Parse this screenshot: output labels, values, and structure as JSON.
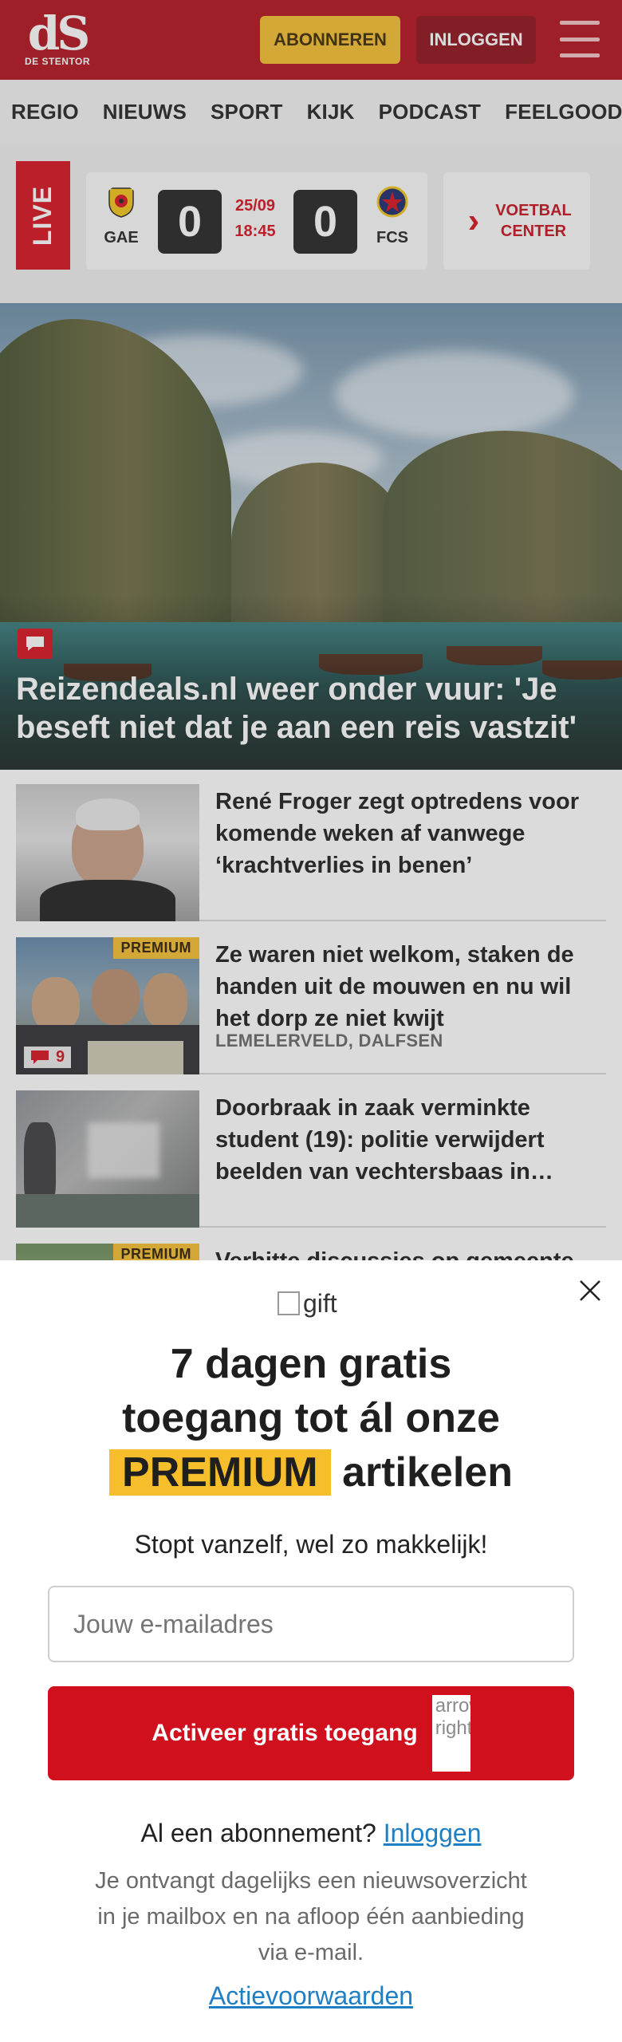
{
  "header": {
    "logo_mark": "dS",
    "logo_text": "DE STENTOR",
    "subscribe_label": "ABONNEREN",
    "login_label": "INLOGGEN",
    "colors": {
      "brand_red": "#b20f1a",
      "accent_yellow": "#f7be2c"
    }
  },
  "nav": {
    "items": [
      "REGIO",
      "NIEUWS",
      "SPORT",
      "KIJK",
      "PODCAST",
      "FEELGOOD"
    ]
  },
  "live": {
    "badge": "LIVE",
    "match": {
      "home_code": "GAE",
      "home_score": "0",
      "date": "25/09",
      "time": "18:45",
      "away_score": "0",
      "away_code": "FCS"
    },
    "center_label_line1": "VOETBAL",
    "center_label_line2": "CENTER"
  },
  "hero": {
    "title": "Reizendeals.nl weer onder vuur: 'Je beseft niet dat je aan een reis vastzit'",
    "icon": "comment-icon"
  },
  "articles": [
    {
      "title": "René Froger zegt optredens voor komende weken af vanwege ‘krachtverlies in benen’",
      "location": "",
      "premium": "",
      "comments": ""
    },
    {
      "title": "Ze waren niet welkom, staken de handen uit de mouwen en nu wil het dorp ze niet kwijt",
      "location": "LEMELERVELD, DALFSEN",
      "premium": "PREMIUM",
      "comments": "9"
    },
    {
      "title": "Doorbraak in zaak verminkte student (19): politie verwijdert beelden van vechtersbaas in…",
      "location": "",
      "premium": "",
      "comments": ""
    },
    {
      "title": "Verhitte discussies op gemeente…",
      "location": "",
      "premium": "PREMIUM",
      "comments": ""
    }
  ],
  "modal": {
    "gift_alt": "gift",
    "heading_line1": "7 dagen gratis",
    "heading_line2": "toegang tot ál onze",
    "heading_highlight": "PREMIUM",
    "heading_tail": "artikelen",
    "subheading": "Stopt vanzelf, wel zo makkelijk!",
    "email_placeholder": "Jouw e-mailadres",
    "cta_label": "Activeer gratis toegang",
    "cta_arrow_alt": "arrow-right",
    "already_text": "Al een abonnement?",
    "already_link": "Inloggen",
    "disclaimer": "Je ontvangt dagelijks een nieuwsoverzicht in je mailbox en na afloop één aanbieding via e-mail.",
    "terms_link": "Actievoorwaarden",
    "colors": {
      "cta_red": "#d0101c",
      "link_blue": "#1f7fc4"
    }
  }
}
